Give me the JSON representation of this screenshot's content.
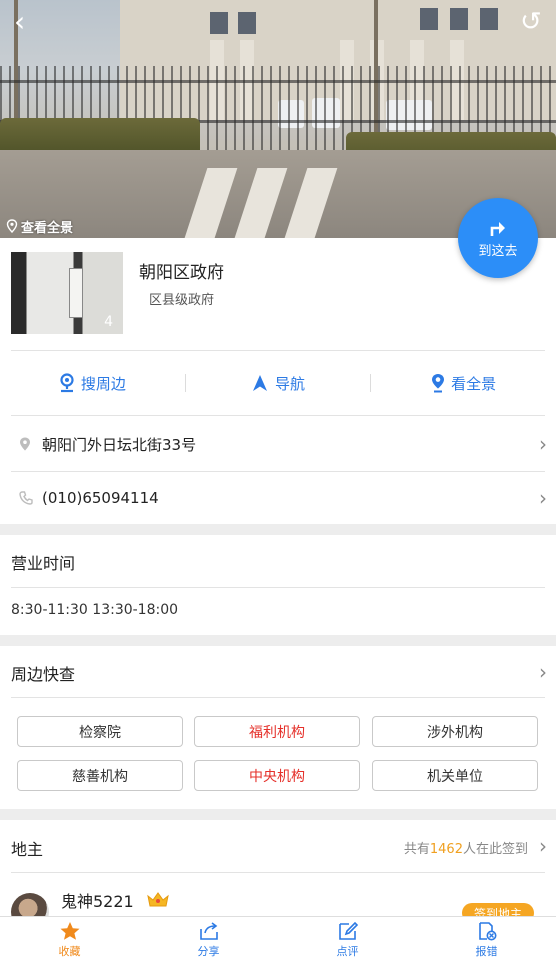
{
  "hero": {
    "pano_link_label": "查看全景"
  },
  "goto_button": {
    "label": "到这去"
  },
  "poi": {
    "name": "朝阳区政府",
    "type": "区县级政府",
    "photo_count": "4"
  },
  "actions": [
    {
      "label": "搜周边",
      "icon": "search-nearby-icon"
    },
    {
      "label": "导航",
      "icon": "navigation-arrow-icon"
    },
    {
      "label": "看全景",
      "icon": "panorama-pin-icon"
    }
  ],
  "address": {
    "text": "朝阳门外日坛北街33号",
    "icon": "location-pin-icon"
  },
  "phone": {
    "text": "(010)65094114",
    "icon": "phone-icon"
  },
  "hours": {
    "title": "营业时间",
    "value": "8:30-11:30 13:30-18:00"
  },
  "nearby": {
    "title": "周边快查",
    "tags": [
      {
        "label": "检察院",
        "highlight": false
      },
      {
        "label": "福利机构",
        "highlight": true
      },
      {
        "label": "涉外机构",
        "highlight": false
      },
      {
        "label": "慈善机构",
        "highlight": false
      },
      {
        "label": "中央机构",
        "highlight": true
      },
      {
        "label": "机关单位",
        "highlight": false
      }
    ]
  },
  "landlord": {
    "title": "地主",
    "count_prefix": "共有",
    "count": "1462",
    "count_suffix": "人在此签到",
    "user_name": "鬼神5221",
    "badge": "签到地主"
  },
  "tabbar": [
    {
      "label": "收藏",
      "icon": "star-icon"
    },
    {
      "label": "分享",
      "icon": "share-icon"
    },
    {
      "label": "点评",
      "icon": "edit-review-icon"
    },
    {
      "label": "报错",
      "icon": "report-error-icon"
    }
  ],
  "colors": {
    "accent": "#2c7ae4",
    "goto_button": "#2c8ef8",
    "highlight_tag": "#e5302a",
    "favorite": "#f08a1c",
    "badge": "#f5a623"
  }
}
